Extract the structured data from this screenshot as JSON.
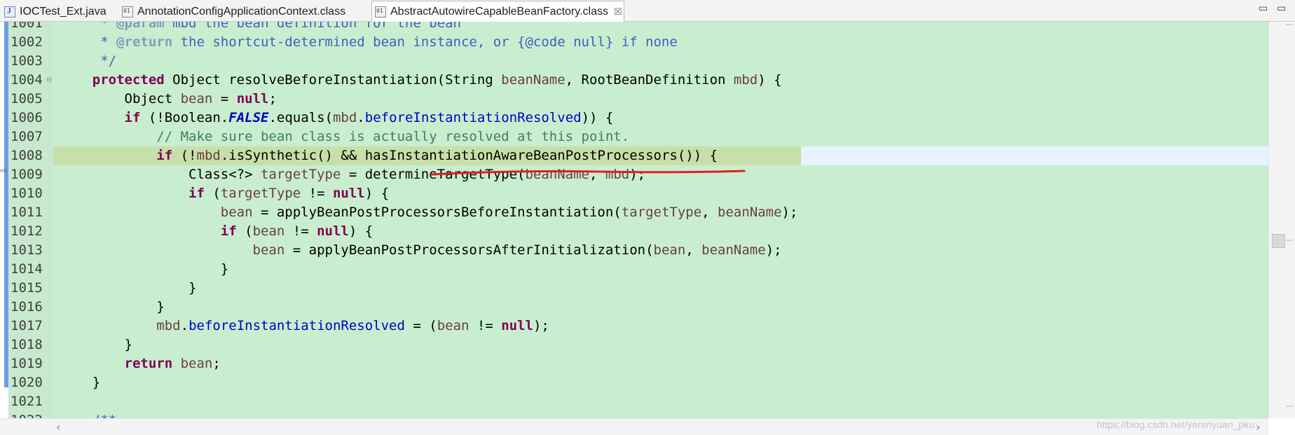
{
  "tabs": [
    {
      "label": "IOCTest_Ext.java",
      "icon": "java-file-icon",
      "active": false
    },
    {
      "label": "AnnotationConfigApplicationContext.class",
      "icon": "class-file-icon",
      "active": false
    },
    {
      "label": "AbstractAutowireCapableBeanFactory.class",
      "icon": "class-file-icon",
      "active": true,
      "close": "☒"
    }
  ],
  "window_controls": {
    "minimize": "▭",
    "maximize": "▭"
  },
  "colors": {
    "editor_background": "#c8eecf",
    "current_line": "#c7dfa9",
    "keyword": "#7f0055",
    "comment": "#3f7f5f",
    "javadoc": "#3f5fbf",
    "field": "#0000c0",
    "annotation_underline": "#e0201a"
  },
  "editor": {
    "current_line_number": "1008",
    "lines": [
      {
        "number": "1001",
        "tokens": [
          [
            "dc",
            "     * "
          ],
          [
            "dtag",
            "@param"
          ],
          [
            "dc",
            " mbd the bean definition for the bean"
          ]
        ]
      },
      {
        "number": "1002",
        "tokens": [
          [
            "dc",
            "     * "
          ],
          [
            "dtag",
            "@return"
          ],
          [
            "dc",
            " the shortcut-determined bean instance, or {@code null} if none"
          ]
        ]
      },
      {
        "number": "1003",
        "tokens": [
          [
            "dc",
            "     */"
          ]
        ]
      },
      {
        "number": "1004",
        "fold": "⊖",
        "tokens": [
          [
            "",
            "    "
          ],
          [
            "kw",
            "protected"
          ],
          [
            "",
            " Object resolveBeforeInstantiation(String "
          ],
          [
            "par",
            "beanName"
          ],
          [
            "",
            ", RootBeanDefinition "
          ],
          [
            "par",
            "mbd"
          ],
          [
            "",
            ") {"
          ]
        ]
      },
      {
        "number": "1005",
        "tokens": [
          [
            "",
            "        Object "
          ],
          [
            "par",
            "bean"
          ],
          [
            "",
            " = "
          ],
          [
            "kw",
            "null"
          ],
          [
            "",
            ";"
          ]
        ]
      },
      {
        "number": "1006",
        "tokens": [
          [
            "",
            "        "
          ],
          [
            "kw",
            "if"
          ],
          [
            "",
            " (!Boolean."
          ],
          [
            "sfi",
            "FALSE"
          ],
          [
            "",
            ".equals("
          ],
          [
            "par",
            "mbd"
          ],
          [
            "",
            "."
          ],
          [
            "fld",
            "beforeInstantiationResolved"
          ],
          [
            "",
            ")) {"
          ]
        ]
      },
      {
        "number": "1007",
        "tokens": [
          [
            "",
            "            "
          ],
          [
            "cm",
            "// Make sure bean class is actually resolved at this point."
          ]
        ]
      },
      {
        "number": "1008",
        "current": true,
        "tokens": [
          [
            "",
            "            "
          ],
          [
            "kw",
            "if"
          ],
          [
            "",
            " (!"
          ],
          [
            "par",
            "mbd"
          ],
          [
            "",
            ".isSynthetic() && hasInstantiationAwareBeanPostProcessors()) {"
          ]
        ]
      },
      {
        "number": "1009",
        "tokens": [
          [
            "",
            "                Class<?> "
          ],
          [
            "par",
            "targetType"
          ],
          [
            "",
            " = determineTargetType("
          ],
          [
            "par",
            "beanName"
          ],
          [
            "",
            ", "
          ],
          [
            "par",
            "mbd"
          ],
          [
            "",
            ");"
          ]
        ]
      },
      {
        "number": "1010",
        "tokens": [
          [
            "",
            "                "
          ],
          [
            "kw",
            "if"
          ],
          [
            "",
            " ("
          ],
          [
            "par",
            "targetType"
          ],
          [
            "",
            " != "
          ],
          [
            "kw",
            "null"
          ],
          [
            "",
            ") {"
          ]
        ]
      },
      {
        "number": "1011",
        "tokens": [
          [
            "",
            "                    "
          ],
          [
            "par",
            "bean"
          ],
          [
            "",
            " = applyBeanPostProcessorsBeforeInstantiation("
          ],
          [
            "par",
            "targetType"
          ],
          [
            "",
            ", "
          ],
          [
            "par",
            "beanName"
          ],
          [
            "",
            ");"
          ]
        ]
      },
      {
        "number": "1012",
        "tokens": [
          [
            "",
            "                    "
          ],
          [
            "kw",
            "if"
          ],
          [
            "",
            " ("
          ],
          [
            "par",
            "bean"
          ],
          [
            "",
            " != "
          ],
          [
            "kw",
            "null"
          ],
          [
            "",
            ") {"
          ]
        ]
      },
      {
        "number": "1013",
        "tokens": [
          [
            "",
            "                        "
          ],
          [
            "par",
            "bean"
          ],
          [
            "",
            " = applyBeanPostProcessorsAfterInitialization("
          ],
          [
            "par",
            "bean"
          ],
          [
            "",
            ", "
          ],
          [
            "par",
            "beanName"
          ],
          [
            "",
            ");"
          ]
        ]
      },
      {
        "number": "1014",
        "tokens": [
          [
            "",
            "                    }"
          ]
        ]
      },
      {
        "number": "1015",
        "tokens": [
          [
            "",
            "                }"
          ]
        ]
      },
      {
        "number": "1016",
        "tokens": [
          [
            "",
            "            }"
          ]
        ]
      },
      {
        "number": "1017",
        "tokens": [
          [
            "",
            "            "
          ],
          [
            "par",
            "mbd"
          ],
          [
            "",
            "."
          ],
          [
            "fld",
            "beforeInstantiationResolved"
          ],
          [
            "",
            " = ("
          ],
          [
            "par",
            "bean"
          ],
          [
            "",
            " != "
          ],
          [
            "kw",
            "null"
          ],
          [
            "",
            ");"
          ]
        ]
      },
      {
        "number": "1018",
        "tokens": [
          [
            "",
            "        }"
          ]
        ]
      },
      {
        "number": "1019",
        "tokens": [
          [
            "",
            "        "
          ],
          [
            "kw",
            "return"
          ],
          [
            "",
            " "
          ],
          [
            "par",
            "bean"
          ],
          [
            "",
            ";"
          ]
        ]
      },
      {
        "number": "1020",
        "tokens": [
          [
            "",
            "    }"
          ]
        ]
      },
      {
        "number": "1021",
        "tokens": [
          [
            "",
            ""
          ]
        ]
      },
      {
        "number": "1022",
        "tokens": [
          [
            "dc",
            "    /**"
          ]
        ]
      }
    ]
  },
  "watermark": "https://blog.csdn.net/yerenyuan_pku"
}
